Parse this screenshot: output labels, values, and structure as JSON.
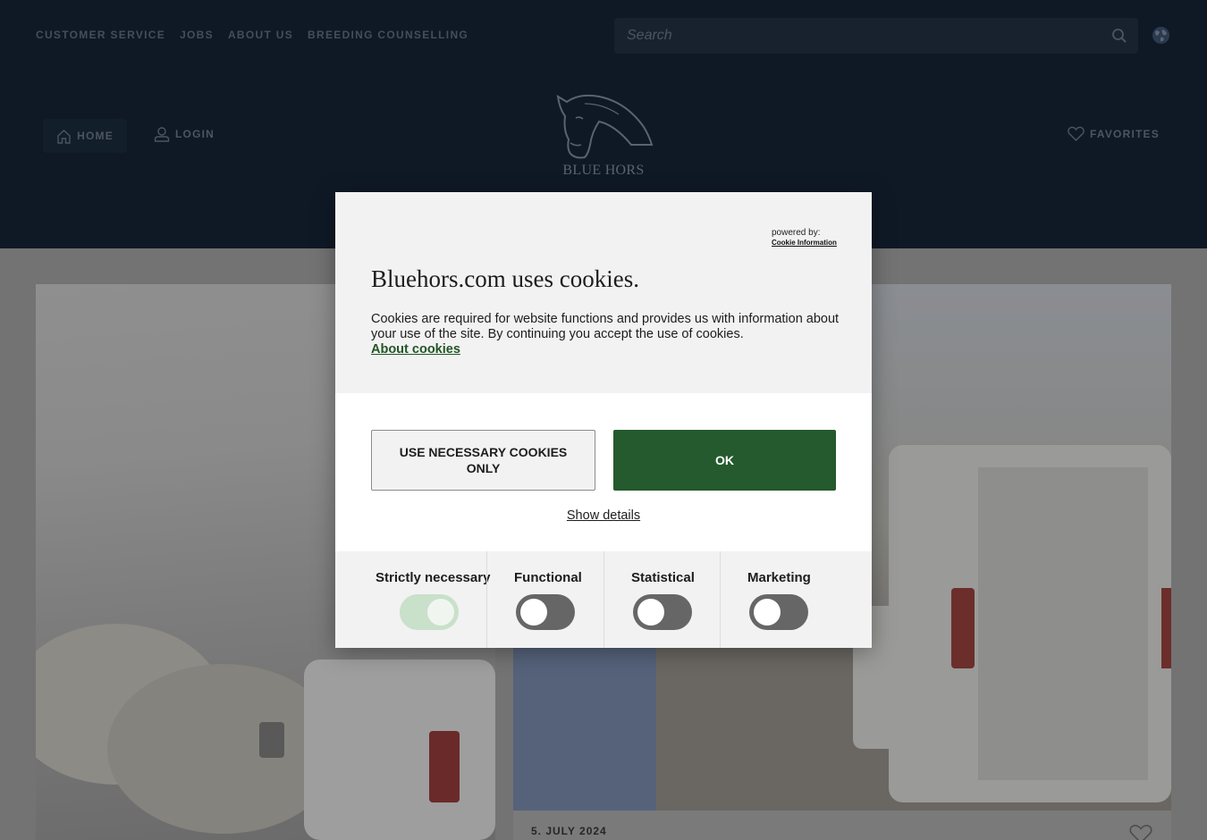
{
  "header": {
    "top_links": [
      "CUSTOMER SERVICE",
      "JOBS",
      "ABOUT US",
      "BREEDING COUNSELLING"
    ],
    "search_placeholder": "Search",
    "home_label": "HOME",
    "login_label": "LOGIN",
    "favorites_label": "FAVORITES",
    "logo_text": "BLUE HORS"
  },
  "content": {
    "card_date": "5. JULY 2024"
  },
  "cookie_dialog": {
    "powered_by_label": "powered by:",
    "powered_by_link": "Cookie Information",
    "title": "Bluehors.com uses cookies.",
    "body": "Cookies are required for website functions and provides us with information about your use of the site. By continuing you accept the use of cookies.",
    "about_link": "About cookies",
    "necessary_button": "USE NECESSARY COOKIES ONLY",
    "ok_button": "OK",
    "show_details": "Show details",
    "categories": [
      {
        "label": "Strictly necessary",
        "enabled": true,
        "locked": true
      },
      {
        "label": "Functional",
        "enabled": false
      },
      {
        "label": "Statistical",
        "enabled": false
      },
      {
        "label": "Marketing",
        "enabled": false
      }
    ]
  },
  "colors": {
    "header_bg": "#0f1926",
    "accept_green": "#245a2d",
    "link_green": "#215625",
    "overlay_grey": "#737373"
  }
}
